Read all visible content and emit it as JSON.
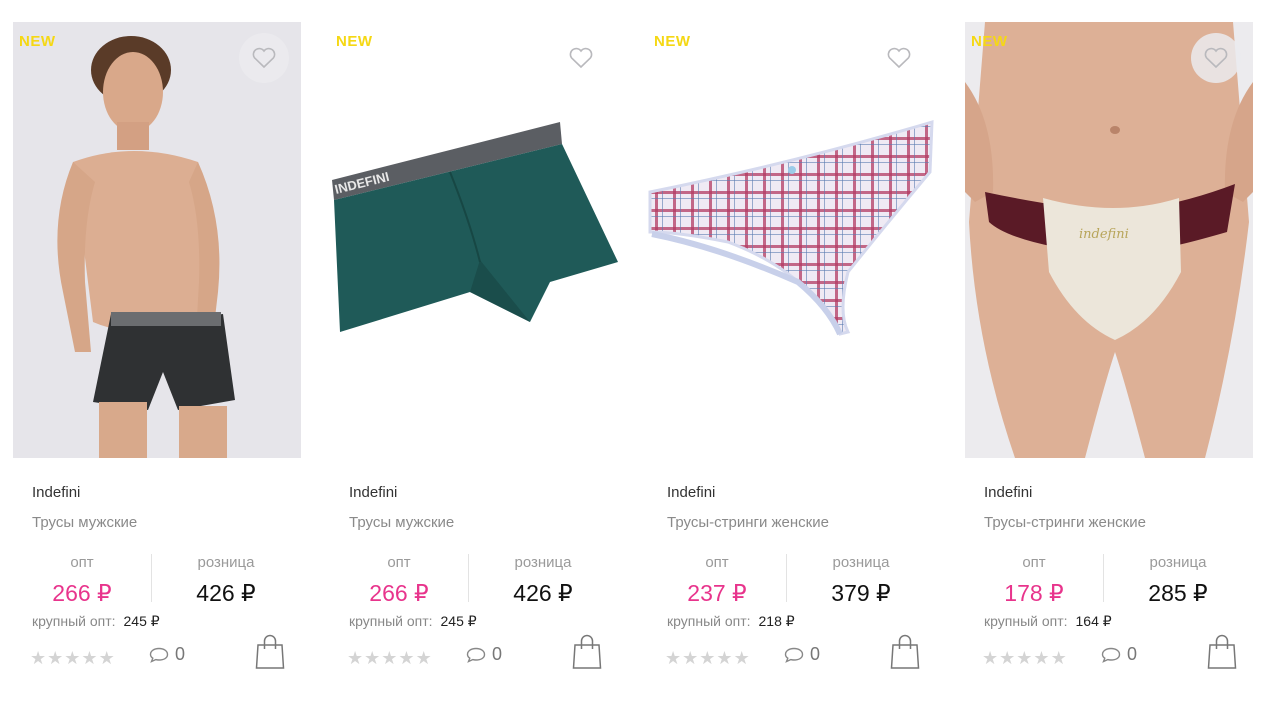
{
  "products": [
    {
      "badge": "NEW",
      "brand": "Indefini",
      "title": "Трусы мужские",
      "opt_label": "опт",
      "opt_price": "266 ₽",
      "retail_label": "розница",
      "retail_price": "426 ₽",
      "bulk_label": "крупный опт:",
      "bulk_price": "245 ₽",
      "comments": "0",
      "image_icon": "male-model-boxers-image"
    },
    {
      "badge": "NEW",
      "brand": "Indefini",
      "title": "Трусы мужские",
      "opt_label": "опт",
      "opt_price": "266 ₽",
      "retail_label": "розница",
      "retail_price": "426 ₽",
      "bulk_label": "крупный опт:",
      "bulk_price": "245 ₽",
      "comments": "0",
      "image_icon": "green-boxer-briefs-image"
    },
    {
      "badge": "NEW",
      "brand": "Indefini",
      "title": "Трусы-стринги женские",
      "opt_label": "опт",
      "opt_price": "237 ₽",
      "retail_label": "розница",
      "retail_price": "379 ₽",
      "bulk_label": "крупный опт:",
      "bulk_price": "218 ₽",
      "comments": "0",
      "image_icon": "plaid-thong-image"
    },
    {
      "badge": "NEW",
      "brand": "Indefini",
      "title": "Трусы-стринги женские",
      "opt_label": "опт",
      "opt_price": "178 ₽",
      "retail_label": "розница",
      "retail_price": "285 ₽",
      "bulk_label": "крупный опт:",
      "bulk_price": "164 ₽",
      "comments": "0",
      "image_icon": "lace-thong-model-image"
    }
  ],
  "product_images_text": {
    "boxer_waistband": "INDEFINI",
    "thong_embroidery": "indefini"
  },
  "colors": {
    "opt_price": "#e8348c",
    "badge": "#f5d814",
    "stars": "#d4d4d4"
  }
}
